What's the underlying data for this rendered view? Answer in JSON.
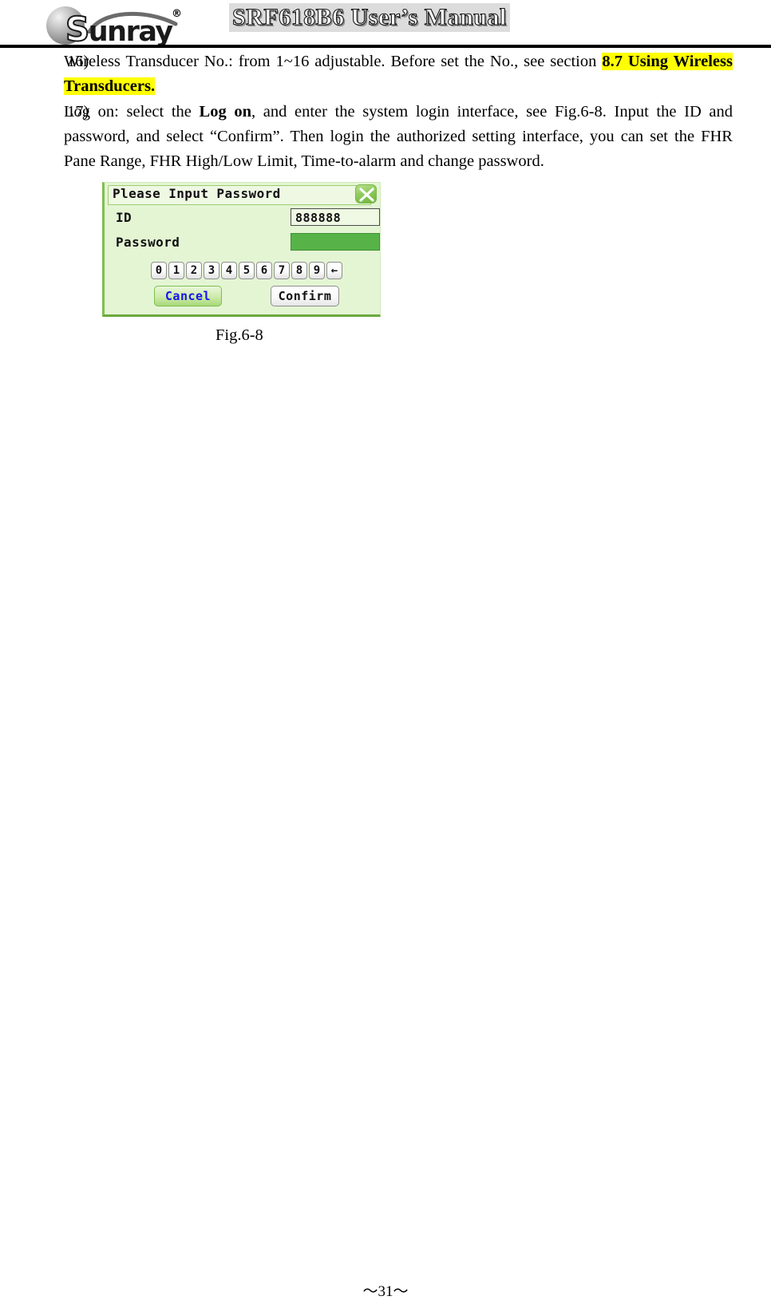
{
  "header": {
    "logo_text_cap": "S",
    "logo_text_rest": "unray",
    "registered_mark": "®",
    "title": "SRF618B6 User’s Manual"
  },
  "content": {
    "items": [
      {
        "marker": "16)",
        "text_before": "Wireless Transducer No.: from 1~16 adjustable. Before set the No., see section ",
        "highlight": "8.7 Using Wireless Transducers.",
        "text_after": ""
      },
      {
        "marker": "17)",
        "seg1": "Log on: select the ",
        "bold1": "Log on",
        "seg2": ", and enter the system login interface, see Fig.6-8. Input the ID and password, and select “Confirm”. Then login the authorized setting interface, you can set the FHR Pane Range, FHR High/Low Limit, Time-to-alarm and change password."
      }
    ]
  },
  "figure": {
    "caption": "Fig.6-8",
    "dialog": {
      "title": "Please Input Password",
      "close_icon": "close-x-icon",
      "id_label": "ID",
      "id_value": "888888",
      "password_label": "Password",
      "password_value": "",
      "keys": [
        "0",
        "1",
        "2",
        "3",
        "4",
        "5",
        "6",
        "7",
        "8",
        "9",
        "←"
      ],
      "cancel_label": "Cancel",
      "confirm_label": "Confirm",
      "colors": {
        "dialog_bg": "#e4f5d4",
        "titlebar_bg": "#eef8e3",
        "password_field_bg": "#57b348",
        "cancel_text": "#1414ee",
        "accent_green": "#7fbf4f"
      }
    }
  },
  "footer": {
    "page_number": "～31～"
  }
}
